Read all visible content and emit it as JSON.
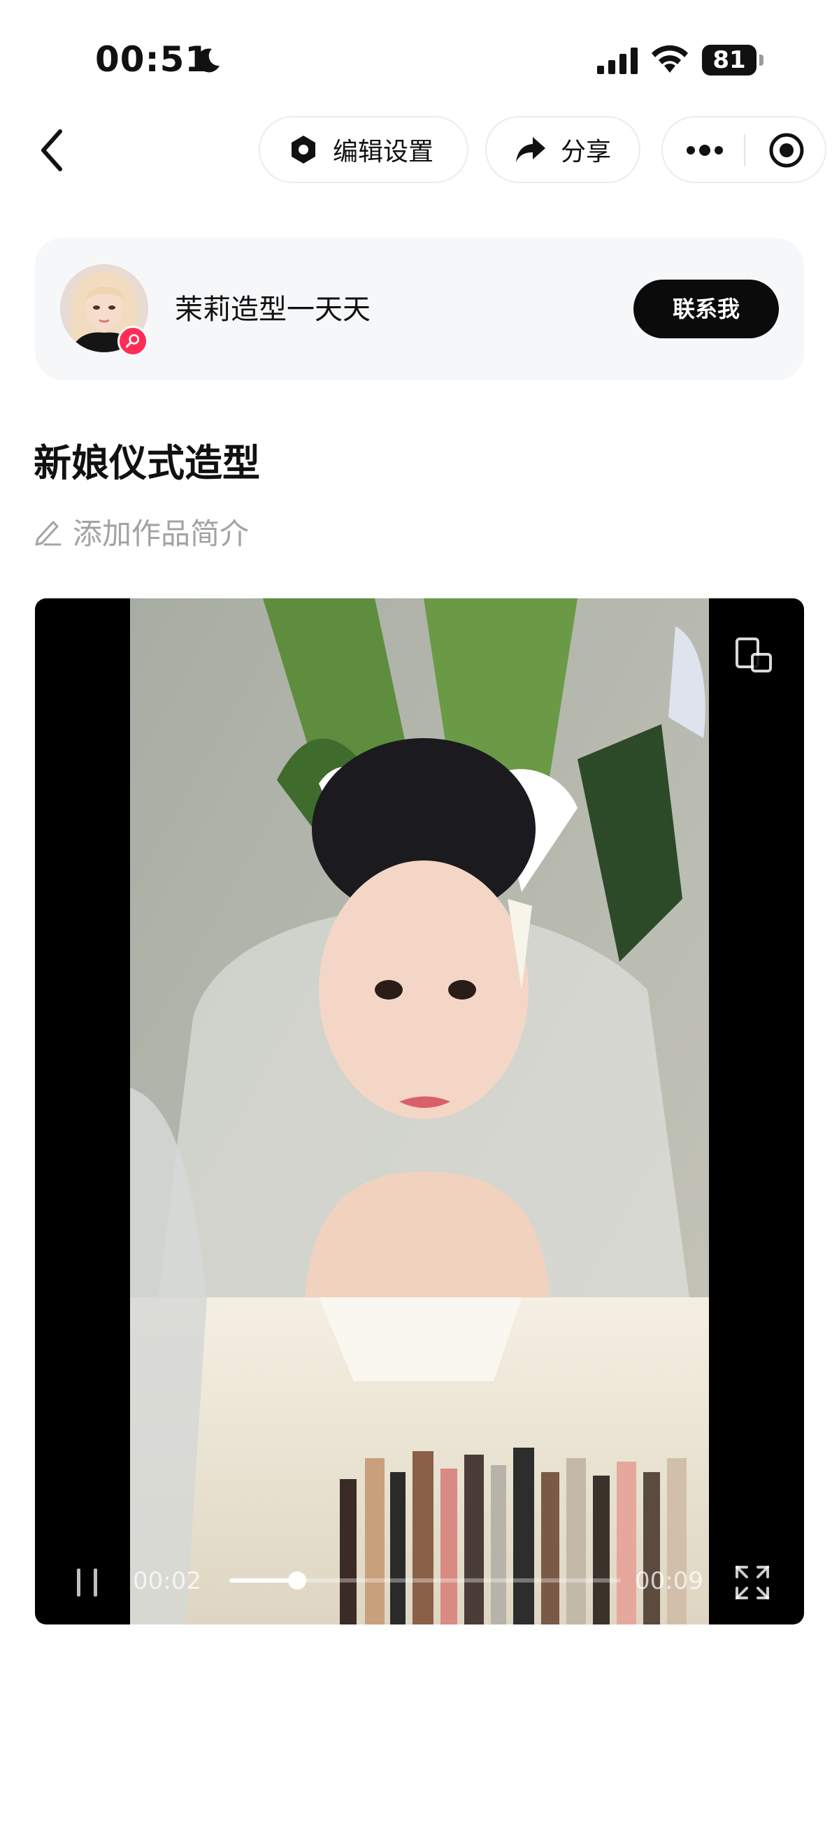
{
  "status_bar": {
    "time": "00:51",
    "battery": "81"
  },
  "nav": {
    "back_icon": "chevron-left-icon",
    "edit_settings_label": "编辑设置",
    "edit_settings_icon": "gear-hexagon-icon",
    "share_label": "分享",
    "share_icon": "share-arrow-icon",
    "more_icon": "more-dots-icon",
    "target_icon": "target-circle-icon"
  },
  "profile": {
    "name": "茉莉造型一天天",
    "contact_label": "联系我",
    "badge_icon": "search-badge-icon",
    "badge_color": "#ff2d55"
  },
  "work": {
    "title": "新娘仪式造型",
    "add_intro_label": "添加作品简介",
    "add_intro_icon": "pencil-icon"
  },
  "player": {
    "current_time": "00:02",
    "total_time": "00:09",
    "progress": 0.173,
    "state": "playing",
    "pause_icon": "pause-icon",
    "pip_icon": "picture-in-picture-icon",
    "fullscreen_icon": "fullscreen-icon"
  },
  "colors": {
    "text": "#111111",
    "muted": "#a3a3a3",
    "card_bg": "#f6f7f9",
    "button_dark": "#0b0b0b",
    "accent": "#ff2d55"
  }
}
